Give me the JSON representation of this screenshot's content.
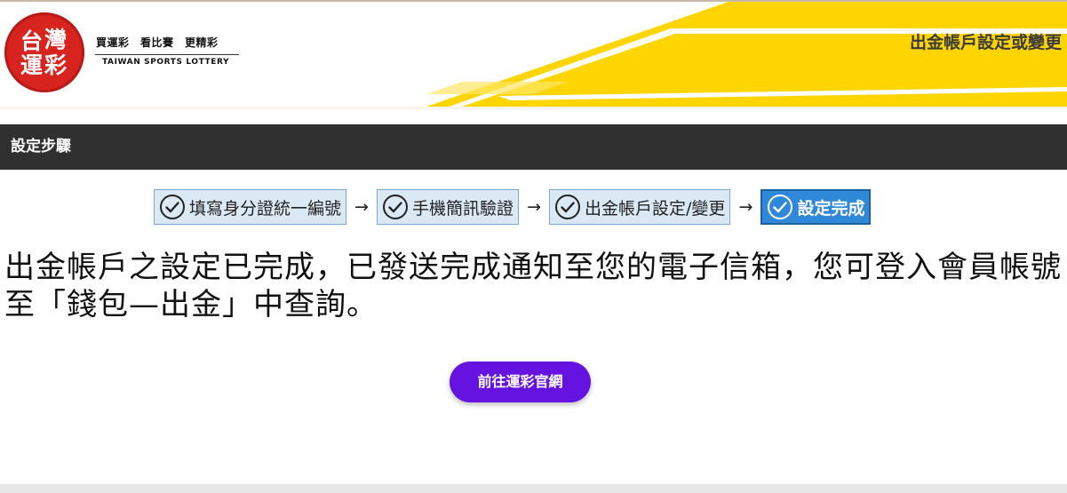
{
  "header": {
    "logo": {
      "chars": [
        "台",
        "灣",
        "運",
        "彩"
      ],
      "slogan": "買運彩　看比賽　更精彩",
      "english": "TAIWAN SPORTS LOTTERY",
      "red": "#d7241f"
    },
    "title": "出金帳戶設定或變更",
    "accent_yellow": "#ffd500"
  },
  "steps_bar": {
    "label": "設定步驟"
  },
  "steps": [
    {
      "label": "填寫身分證統一編號",
      "icon": "check-circle-icon",
      "active": false
    },
    {
      "label": "手機簡訊驗證",
      "icon": "check-circle-icon",
      "active": false
    },
    {
      "label": "出金帳戶設定/變更",
      "icon": "check-circle-icon",
      "active": false
    },
    {
      "label": "設定完成",
      "icon": "check-circle-icon",
      "active": true
    }
  ],
  "arrow_glyph": "→",
  "message": "出金帳戶之設定已完成，已發送完成通知至您的電子信箱，您可登入會員帳號至「錢包—出金」中查詢。",
  "button": {
    "label": "前往運彩官網",
    "color": "#6513e0"
  }
}
